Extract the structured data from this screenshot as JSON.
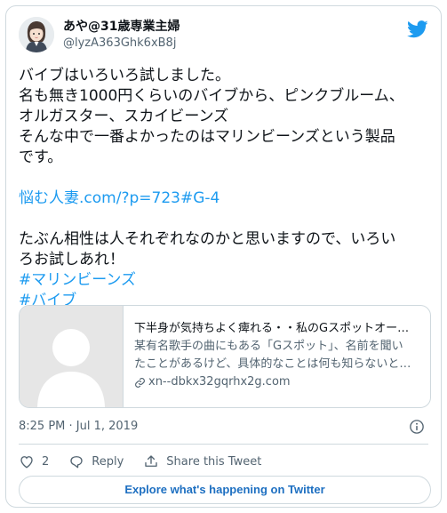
{
  "author": {
    "display_name": "あや@31歳専業主婦",
    "handle": "@lyzA363Ghk6xB8j"
  },
  "tweet": {
    "lines": [
      "バイブはいろいろ試しました。",
      "名も無き1000円くらいのバイブから、ピンクブルーム、",
      "オルガスター、スカイビーンズ",
      "そんな中で一番よかったのはマリンビーンズという製品",
      "です。"
    ],
    "link_text": "悩む人妻.com/?p=723#G-4",
    "lines_after": [
      "たぶん相性は人それぞれなのかと思いますので、いろい",
      "ろお試しあれ！"
    ],
    "hashtags": [
      "#マリンビーンズ",
      "#バイブ"
    ]
  },
  "link_card": {
    "title": "下半身が気持ちよく痺れる・・私のGスポットオー…",
    "description_line1": "某有名歌手の曲にもある「Gスポット」、名前を聞い",
    "description_line2": "たことがあるけど、具体的なことは何も知らないと…",
    "domain": "xn--dbkx32gqrhx2g.com"
  },
  "timestamp": "8:25 PM · Jul 1, 2019",
  "actions": {
    "like_count": "2",
    "reply_label": "Reply",
    "share_label": "Share this Tweet"
  },
  "explore_label": "Explore what's happening on Twitter",
  "colors": {
    "accent": "#1d9bf0",
    "border": "#cfd9de",
    "muted": "#536471"
  }
}
